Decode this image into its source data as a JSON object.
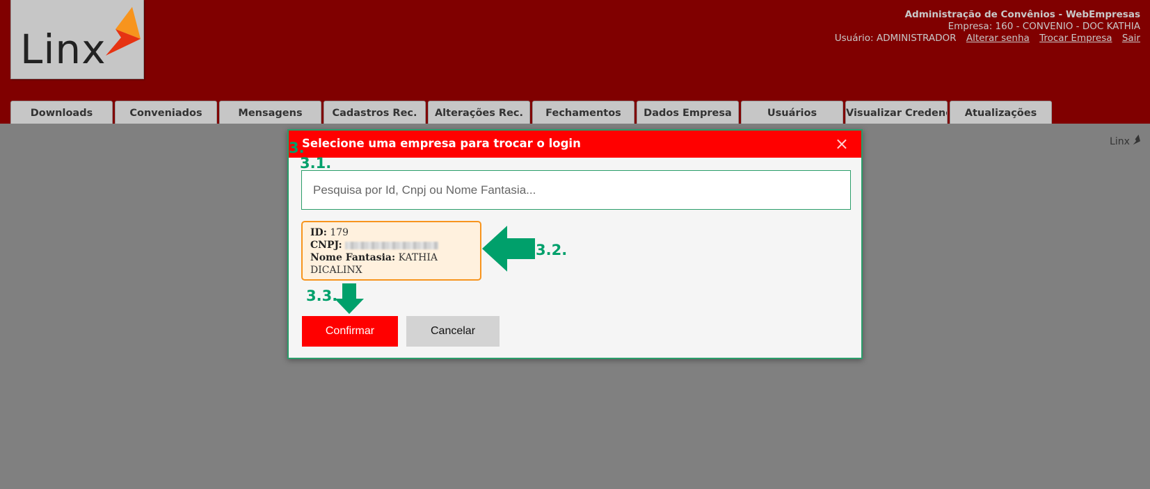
{
  "header": {
    "logo_text": "Linx",
    "app_title": "Administração de Convênios - WebEmpresas",
    "company_line": "Empresa: 160 - CONVENIO - DOC KATHIA",
    "user_line": "Usuário: ADMINISTRADOR",
    "links": [
      "Alterar senha",
      "Trocar Empresa",
      "Sair"
    ]
  },
  "tabs": [
    "Downloads",
    "Conveniados",
    "Mensagens",
    "Cadastros Rec.",
    "Alterações Rec.",
    "Fechamentos",
    "Dados Empresa",
    "Usuários",
    "Visualizar Credencial",
    "Atualizações"
  ],
  "content": {
    "corner_logo": "Linx"
  },
  "modal": {
    "title": "Selecione uma empresa para trocar o login",
    "close_glyph": "×",
    "search_placeholder": "Pesquisa por Id, Cnpj ou Nome Fantasia...",
    "company": {
      "id_label": "ID:",
      "id_value": "179",
      "cnpj_label": "CNPJ:",
      "name_label": "Nome Fantasia:",
      "name_value": "KATHIA DICALINX"
    },
    "confirm_label": "Confirmar",
    "cancel_label": "Cancelar"
  },
  "annotations": [
    "3.",
    "3.1.",
    "3.2.",
    "3.3."
  ],
  "colors": {
    "header_bg": "#800000",
    "modal_header": "#ff0000",
    "annotation_green": "#00a06b",
    "card_border": "#f7941d",
    "page_bg": "#808080"
  }
}
